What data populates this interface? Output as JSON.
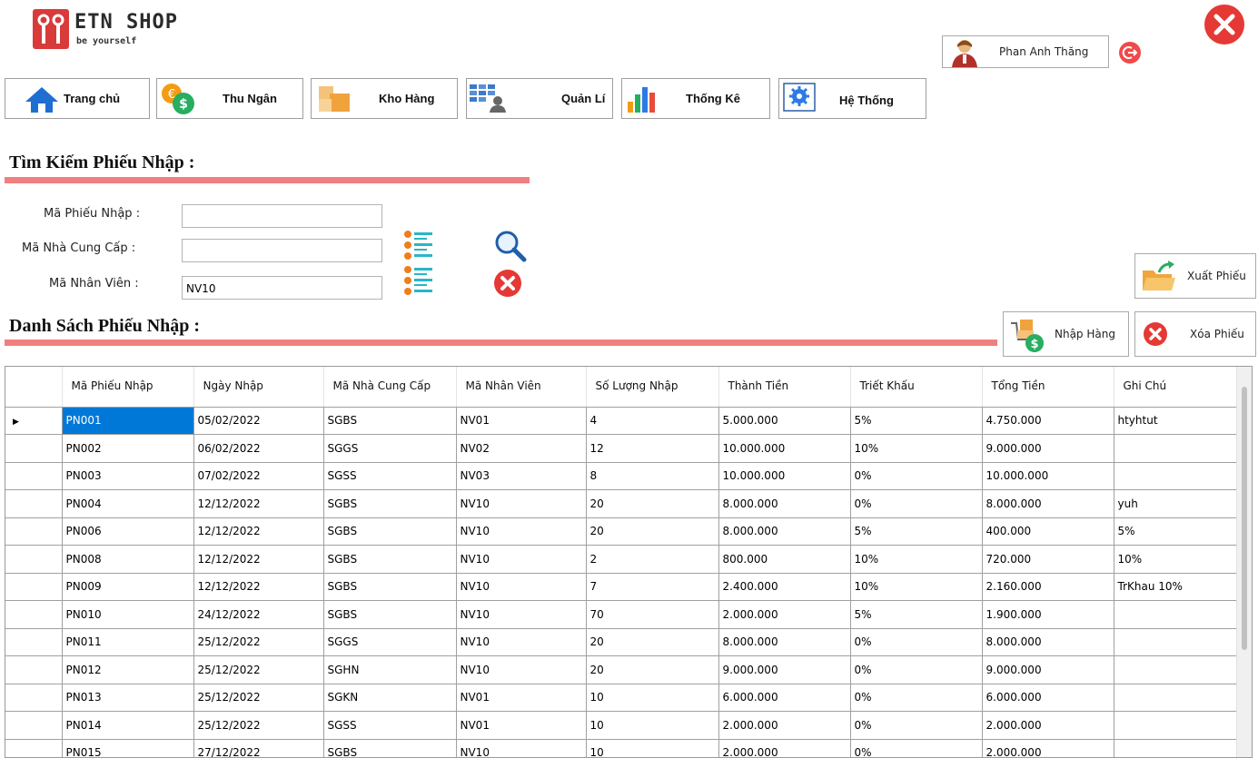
{
  "app": {
    "logo_title": "ETN SHOP",
    "logo_subtitle": "be yourself",
    "user_name": "Phan Anh Thăng"
  },
  "nav": [
    {
      "label": "Trang chủ",
      "icon": "home-icon"
    },
    {
      "label": "Thu Ngân",
      "icon": "cashier-icon"
    },
    {
      "label": "Kho Hàng",
      "icon": "warehouse-icon"
    },
    {
      "label": "Quản Lí",
      "icon": "manage-icon"
    },
    {
      "label": "Thống Kê",
      "icon": "chart-icon"
    },
    {
      "label": "Hệ Thống",
      "icon": "system-gear-icon"
    }
  ],
  "search": {
    "heading": "Tìm Kiếm Phiếu Nhập :",
    "fields": {
      "receipt_label": "Mã Phiếu Nhập :",
      "receipt_value": "",
      "supplier_label": "Mã Nhà Cung Cấp :",
      "supplier_value": "",
      "employee_label": "Mã Nhân Viên :",
      "employee_value": "NV10"
    }
  },
  "list": {
    "heading": "Danh Sách Phiếu Nhập :",
    "actions": {
      "export_label": "Xuất Phiếu",
      "import_label": "Nhập Hàng",
      "delete_label": "Xóa Phiếu"
    },
    "columns": [
      "Mã Phiếu Nhập",
      "Ngày Nhập",
      "Mã Nhà Cung Cấp",
      "Mã Nhân Viên",
      "Số Lượng Nhập",
      "Thành Tiền",
      "Triết Khấu",
      "Tổng Tiền",
      "Ghi Chú"
    ],
    "rows": [
      [
        "PN001",
        "05/02/2022",
        "SGBS",
        "NV01",
        "4",
        "5.000.000",
        "5%",
        "4.750.000",
        "htyhtut"
      ],
      [
        "PN002",
        "06/02/2022",
        "SGGS",
        "NV02",
        "12",
        "10.000.000",
        "10%",
        "9.000.000",
        ""
      ],
      [
        "PN003",
        "07/02/2022",
        "SGSS",
        "NV03",
        "8",
        "10.000.000",
        "0%",
        "10.000.000",
        ""
      ],
      [
        "PN004",
        "12/12/2022",
        "SGBS",
        "NV10",
        "20",
        "8.000.000",
        "0%",
        "8.000.000",
        "yuh"
      ],
      [
        "PN006",
        "12/12/2022",
        "SGBS",
        "NV10",
        "20",
        "8.000.000",
        "5%",
        "400.000",
        "5%"
      ],
      [
        "PN008",
        "12/12/2022",
        "SGBS",
        "NV10",
        "2",
        "800.000",
        "10%",
        "720.000",
        "10%"
      ],
      [
        "PN009",
        "12/12/2022",
        "SGBS",
        "NV10",
        "7",
        "2.400.000",
        "10%",
        "2.160.000",
        "TrKhau 10%"
      ],
      [
        "PN010",
        "24/12/2022",
        "SGBS",
        "NV10",
        "70",
        "2.000.000",
        "5%",
        "1.900.000",
        ""
      ],
      [
        "PN011",
        "25/12/2022",
        "SGGS",
        "NV10",
        "20",
        "8.000.000",
        "0%",
        "8.000.000",
        ""
      ],
      [
        "PN012",
        "25/12/2022",
        "SGHN",
        "NV10",
        "20",
        "9.000.000",
        "0%",
        "9.000.000",
        ""
      ],
      [
        "PN013",
        "25/12/2022",
        "SGKN",
        "NV01",
        "10",
        "6.000.000",
        "0%",
        "6.000.000",
        ""
      ],
      [
        "PN014",
        "25/12/2022",
        "SGSS",
        "NV01",
        "10",
        "2.000.000",
        "0%",
        "2.000.000",
        ""
      ],
      [
        "PN015",
        "27/12/2022",
        "SGBS",
        "NV10",
        "10",
        "2.000.000",
        "0%",
        "2.000.000",
        ""
      ]
    ]
  },
  "colors": {
    "accent_red": "#f08080",
    "close_red": "#e53935",
    "selection_blue": "#0078d7"
  }
}
